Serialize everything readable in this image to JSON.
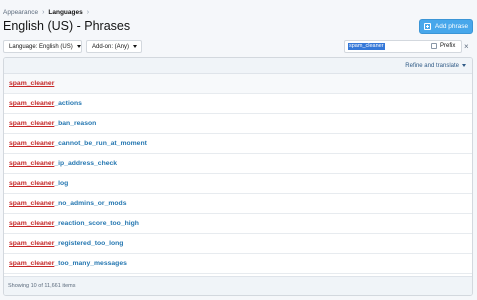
{
  "breadcrumb": {
    "items": [
      "Appearance",
      "Languages"
    ]
  },
  "page_title": "English (US) - Phrases",
  "add_button": {
    "label": "Add phrase",
    "icon": "add-box-icon"
  },
  "filters": {
    "language": "Language: English (US)",
    "addon": "Add-on: (Any)",
    "search_value": "spam_cleaner",
    "prefix_label": "Prefix",
    "prefix_checked": false
  },
  "list": {
    "refine_label": "Refine and translate",
    "rows": [
      {
        "prefix": "spam_cleaner",
        "suffix": ""
      },
      {
        "prefix": "spam_cleaner",
        "suffix": "_actions"
      },
      {
        "prefix": "spam_cleaner",
        "suffix": "_ban_reason"
      },
      {
        "prefix": "spam_cleaner",
        "suffix": "_cannot_be_run_at_moment"
      },
      {
        "prefix": "spam_cleaner",
        "suffix": "_ip_address_check"
      },
      {
        "prefix": "spam_cleaner",
        "suffix": "_log"
      },
      {
        "prefix": "spam_cleaner",
        "suffix": "_no_admins_or_mods"
      },
      {
        "prefix": "spam_cleaner",
        "suffix": "_reaction_score_too_high"
      },
      {
        "prefix": "spam_cleaner",
        "suffix": "_registered_too_long"
      },
      {
        "prefix": "spam_cleaner",
        "suffix": "_too_many_messages"
      }
    ],
    "footer": "Showing 10 of 11,661 items"
  },
  "colors": {
    "accent": "#47a7eb",
    "link": "#2577b1",
    "highlight": "#c62828"
  }
}
